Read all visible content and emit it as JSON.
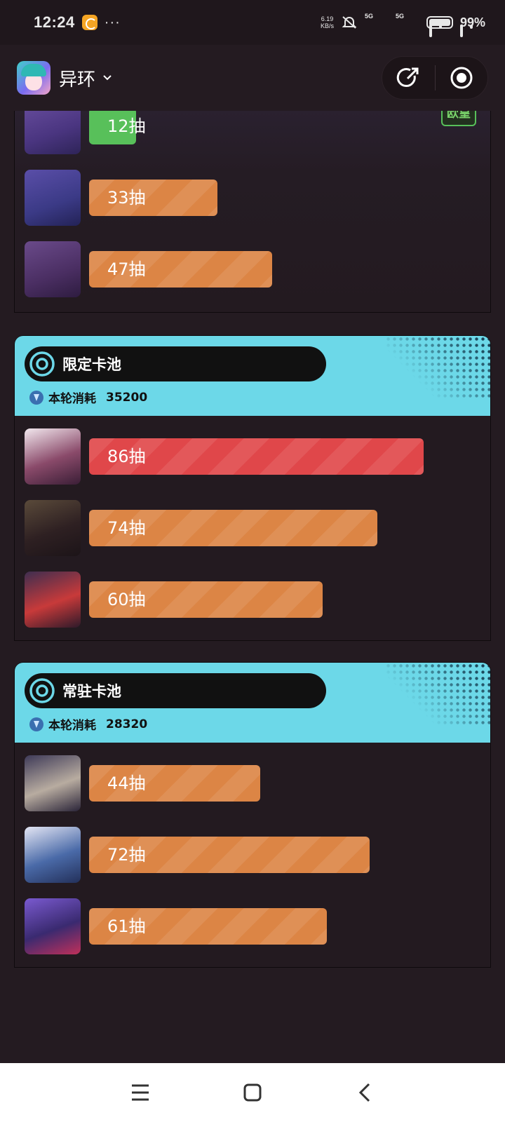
{
  "status_bar": {
    "time": "12:24",
    "dots": "···",
    "net_speed_value": "6.19",
    "net_speed_unit": "KB/s",
    "network_1": "5G",
    "network_2": "5G",
    "battery": "99%"
  },
  "header": {
    "game_name": "异环",
    "share_icon": "share-icon",
    "close_icon": "record-circle-icon"
  },
  "colors": {
    "background": "#241b21",
    "pool_header": "#6cd8e8",
    "bar_orange": "#dc8545",
    "bar_red": "#e0474a",
    "bar_green": "#58c05a"
  },
  "scrolled_pool": {
    "rows": [
      {
        "label": "12抽",
        "pulls": 12,
        "color": "green",
        "badge": "欧皇",
        "icon": "core-item-a"
      },
      {
        "label": "33抽",
        "pulls": 33,
        "color": "orange",
        "icon": "core-item-b"
      },
      {
        "label": "47抽",
        "pulls": 47,
        "color": "orange",
        "icon": "core-item-c"
      }
    ]
  },
  "limited_pool": {
    "title": "限定卡池",
    "consume_label": "本轮消耗",
    "consume_value": "35200",
    "rows": [
      {
        "label": "86抽",
        "pulls": 86,
        "color": "red",
        "icon": "character-1"
      },
      {
        "label": "74抽",
        "pulls": 74,
        "color": "orange",
        "icon": "character-2"
      },
      {
        "label": "60抽",
        "pulls": 60,
        "color": "orange",
        "icon": "character-3"
      }
    ]
  },
  "standard_pool": {
    "title": "常驻卡池",
    "consume_label": "本轮消耗",
    "consume_value": "28320",
    "rows": [
      {
        "label": "44抽",
        "pulls": 44,
        "color": "orange",
        "icon": "character-4"
      },
      {
        "label": "72抽",
        "pulls": 72,
        "color": "orange",
        "icon": "character-5"
      },
      {
        "label": "61抽",
        "pulls": 61,
        "color": "orange",
        "icon": "character-6"
      }
    ]
  },
  "nav": {
    "menu_icon": "menu-icon",
    "home_icon": "home-square-icon",
    "back_icon": "back-chevron-icon"
  }
}
